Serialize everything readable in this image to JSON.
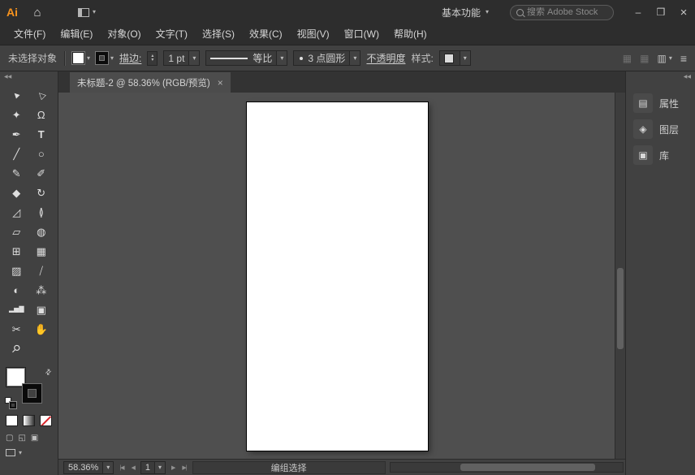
{
  "titlebar": {
    "logo": "Ai",
    "workspace_button": "基本功能",
    "search_placeholder": "搜索 Adobe Stock"
  },
  "menubar": {
    "items": [
      "文件(F)",
      "编辑(E)",
      "对象(O)",
      "文字(T)",
      "选择(S)",
      "效果(C)",
      "视图(V)",
      "窗口(W)",
      "帮助(H)"
    ]
  },
  "controlbar": {
    "selection_status": "未选择对象",
    "stroke_label": "描边:",
    "stroke_width_value": "1 pt",
    "width_profile_value": "等比",
    "brush_definition_value": "3 点圆形",
    "opacity_label": "不透明度",
    "style_label": "样式:"
  },
  "document": {
    "tab_title": "未标题-2 @ 58.36% (RGB/预览)"
  },
  "tools": [
    {
      "name": "selection-tool",
      "glyph": "▲"
    },
    {
      "name": "direct-selection-tool",
      "glyph": "△"
    },
    {
      "name": "magic-wand-tool",
      "glyph": "✦"
    },
    {
      "name": "lasso-tool",
      "glyph": "Ω"
    },
    {
      "name": "pen-tool",
      "glyph": "✒"
    },
    {
      "name": "type-tool",
      "glyph": "T"
    },
    {
      "name": "line-segment-tool",
      "glyph": "╱"
    },
    {
      "name": "ellipse-tool",
      "glyph": "○"
    },
    {
      "name": "paintbrush-tool",
      "glyph": "✎"
    },
    {
      "name": "pencil-tool",
      "glyph": "✐"
    },
    {
      "name": "eraser-tool",
      "glyph": "◆"
    },
    {
      "name": "rotate-tool",
      "glyph": "↻"
    },
    {
      "name": "scale-tool",
      "glyph": "◿"
    },
    {
      "name": "width-tool",
      "glyph": "≬"
    },
    {
      "name": "free-transform-tool",
      "glyph": "▱"
    },
    {
      "name": "shape-builder-tool",
      "glyph": "◍"
    },
    {
      "name": "perspective-grid-tool",
      "glyph": "⊞"
    },
    {
      "name": "mesh-tool",
      "glyph": "▦"
    },
    {
      "name": "gradient-tool",
      "glyph": "▨"
    },
    {
      "name": "eyedropper-tool",
      "glyph": "⧸"
    },
    {
      "name": "blend-tool",
      "glyph": "◐"
    },
    {
      "name": "symbol-sprayer-tool",
      "glyph": "⁂"
    },
    {
      "name": "column-graph-tool",
      "glyph": "▂▅▇"
    },
    {
      "name": "artboard-tool",
      "glyph": "▣"
    },
    {
      "name": "slice-tool",
      "glyph": "✂"
    },
    {
      "name": "hand-tool",
      "glyph": "✋"
    },
    {
      "name": "zoom-tool",
      "glyph": "⚲"
    }
  ],
  "panels": [
    {
      "name": "properties",
      "label": "属性",
      "glyph": "▤"
    },
    {
      "name": "layers",
      "label": "图层",
      "glyph": "◈"
    },
    {
      "name": "libraries",
      "label": "库",
      "glyph": "▣"
    }
  ],
  "statusbar": {
    "zoom_value": "58.36%",
    "artboard_value": "1",
    "status_text": "编组选择"
  },
  "icons": {
    "home": "⌂",
    "caret_down": "▾",
    "stepper_up": "▴",
    "stepper_down": "▾",
    "collapse_double_arrow": "◀◀",
    "swap_colors": "⇄",
    "minimize": "–",
    "maximize": "❒",
    "close": "×",
    "tab_close": "×",
    "nav_first": "|◀",
    "nav_prev": "◀",
    "nav_next": "▶",
    "nav_last": "▶|",
    "panel_menu": "≡",
    "dim_grid": "▦",
    "panel_options": "▥",
    "draw_normal": "▢",
    "draw_behind": "◱",
    "draw_inside": "▣"
  },
  "colors": {
    "logo_orange": "#f7931e",
    "none_indicator_red": "#d8262b",
    "canvas_gray": "#4f4f4f",
    "ui_dark": "#2d2d2d",
    "ui_mid": "#414141",
    "artboard_white": "#ffffff"
  }
}
